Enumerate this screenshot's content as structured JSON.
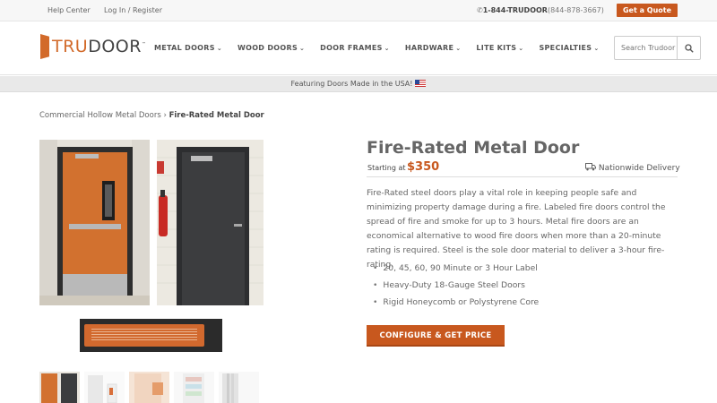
{
  "topbar": {
    "help_center": "Help Center",
    "login": "Log In / Register",
    "phone_main": "1-844-TRUDOOR",
    "phone_numeric": "(844-878-3667)",
    "quote_button": "Get a Quote"
  },
  "logo": {
    "tru": "TRU",
    "door": "DOOR",
    "tm": "™"
  },
  "nav": {
    "items": [
      {
        "label": "METAL DOORS"
      },
      {
        "label": "WOOD DOORS"
      },
      {
        "label": "DOOR FRAMES"
      },
      {
        "label": "HARDWARE"
      },
      {
        "label": "LITE KITS"
      },
      {
        "label": "SPECIALTIES"
      }
    ]
  },
  "search": {
    "placeholder": "Search Trudoor"
  },
  "banner": {
    "text": "Featuring Doors Made in the USA!"
  },
  "breadcrumb": {
    "parent": "Commercial Hollow Metal Doors",
    "separator": "›",
    "current": "Fire-Rated Metal Door"
  },
  "product": {
    "title": "Fire-Rated Metal Door",
    "starting_label": "Starting at",
    "price": "$350",
    "delivery": "Nationwide Delivery",
    "description": "Fire-Rated steel doors play a vital role in keeping people safe and minimizing property damage during a fire. Labeled fire doors control the spread of fire and smoke for up to 3 hours. Metal fire doors are an economical alternative to wood fire doors when more than a 20-minute rating is required. Steel is the sole door material to deliver a 3-hour fire-rating.",
    "features": [
      "20, 45, 60, 90 Minute or 3 Hour Label",
      "Heavy-Duty 18-Gauge Steel Doors",
      "Rigid Honeycomb or Polystyrene Core"
    ],
    "cta": "CONFIGURE & GET PRICE"
  },
  "colors": {
    "accent": "#c8581e",
    "logo_orange": "#d26a2a",
    "door_orange": "#d2712f",
    "door_charcoal": "#3c3d3f"
  }
}
